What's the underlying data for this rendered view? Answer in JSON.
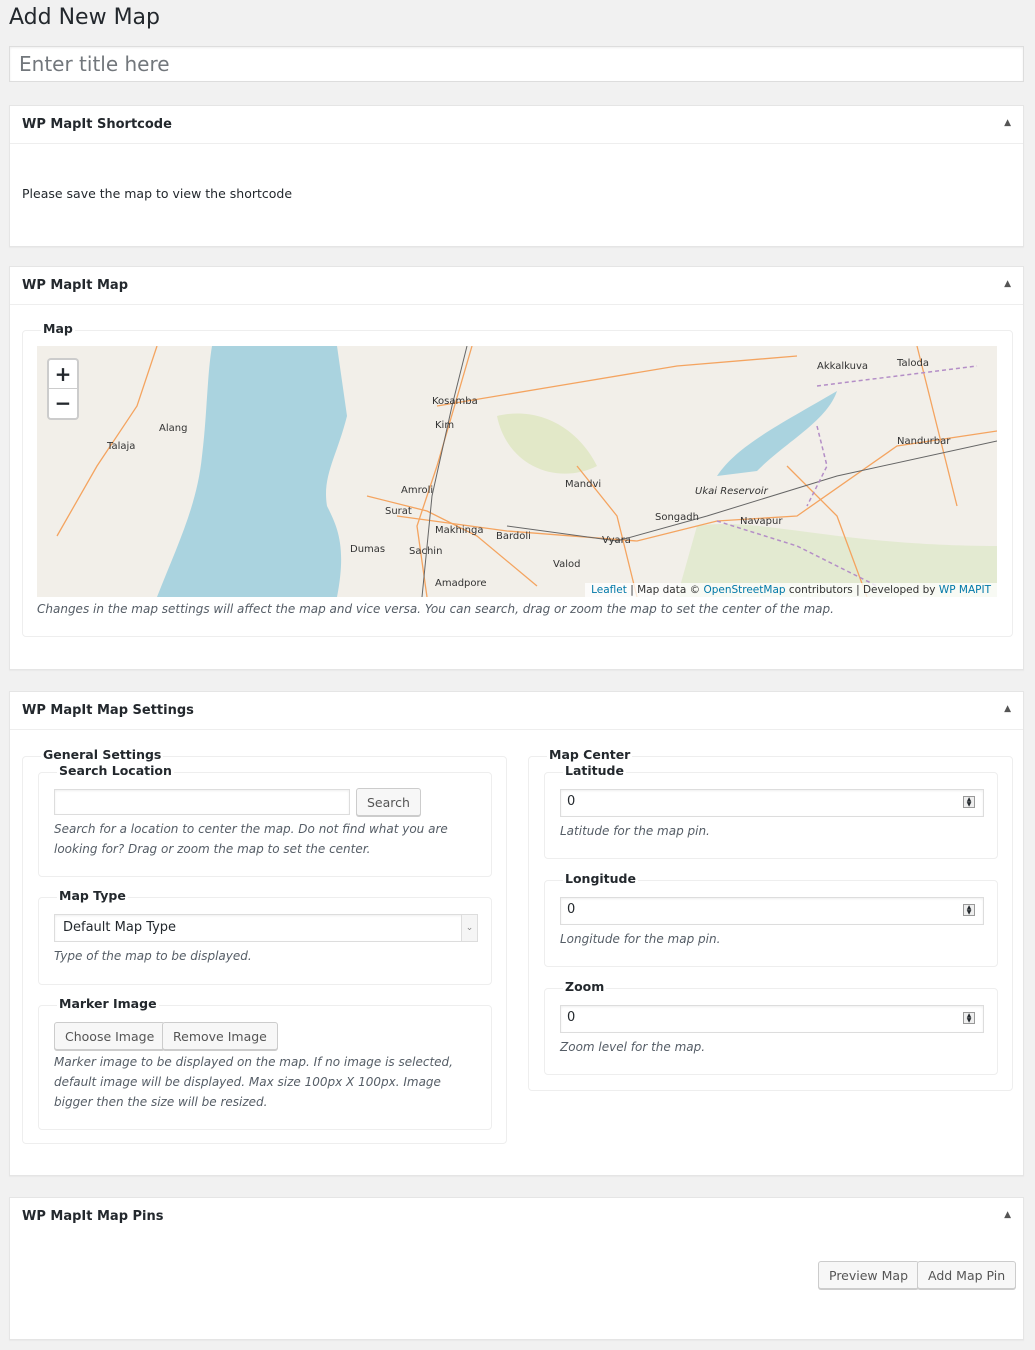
{
  "page_title": "Add New Map",
  "title_input": {
    "placeholder": "Enter title here",
    "value": ""
  },
  "shortcode_box": {
    "title": "WP MapIt Shortcode",
    "message": "Please save the map to view the shortcode"
  },
  "map_box": {
    "title": "WP MapIt Map",
    "legend": "Map",
    "zoom_in": "+",
    "zoom_out": "−",
    "attribution": {
      "leaflet": "Leaflet",
      "sep1": " | Map data © ",
      "osm": "OpenStreetMap",
      "contrib": " contributors | Developed by ",
      "dev": "WP MAPIT"
    },
    "note": "Changes in the map settings will affect the map and vice versa. You can search, drag or zoom the map to set the center of the map.",
    "places": [
      "Kosamba",
      "Kim",
      "Alang",
      "Talaja",
      "Amroli",
      "Surat",
      "Makhinga",
      "Bardoli",
      "Sachin",
      "Dumas",
      "Amadpore",
      "Mandvi",
      "Vyara",
      "Valod",
      "Songadh",
      "Navapur",
      "Ukai Reservoir",
      "Akkalkuva",
      "Taloda",
      "Nandurbar"
    ],
    "colors": {
      "sea": "#aad3df",
      "land": "#f2efe9",
      "road": "#f4a460",
      "link": "#0078a8"
    }
  },
  "settings_box": {
    "title": "WP MapIt Map Settings",
    "general": {
      "legend": "General Settings",
      "search": {
        "legend": "Search Location",
        "value": "",
        "button": "Search",
        "desc": "Search for a location to center the map. Do not find what you are looking for? Drag or zoom the map to set the center."
      },
      "map_type": {
        "legend": "Map Type",
        "selected": "Default Map Type",
        "desc": "Type of the map to be displayed."
      },
      "marker": {
        "legend": "Marker Image",
        "choose": "Choose Image",
        "remove": "Remove Image",
        "desc": "Marker image to be displayed on the map. If no image is selected, default image will be displayed. Max size 100px X 100px. Image bigger then the size will be resized."
      }
    },
    "center": {
      "legend": "Map Center",
      "latitude": {
        "legend": "Latitude",
        "value": "0",
        "desc": "Latitude for the map pin."
      },
      "longitude": {
        "legend": "Longitude",
        "value": "0",
        "desc": "Longitude for the map pin."
      },
      "zoom": {
        "legend": "Zoom",
        "value": "0",
        "desc": "Zoom level for the map."
      }
    }
  },
  "pins_box": {
    "title": "WP MapIt Map Pins",
    "preview": "Preview Map",
    "add_pin": "Add Map Pin"
  },
  "toggle_icon": "▲"
}
